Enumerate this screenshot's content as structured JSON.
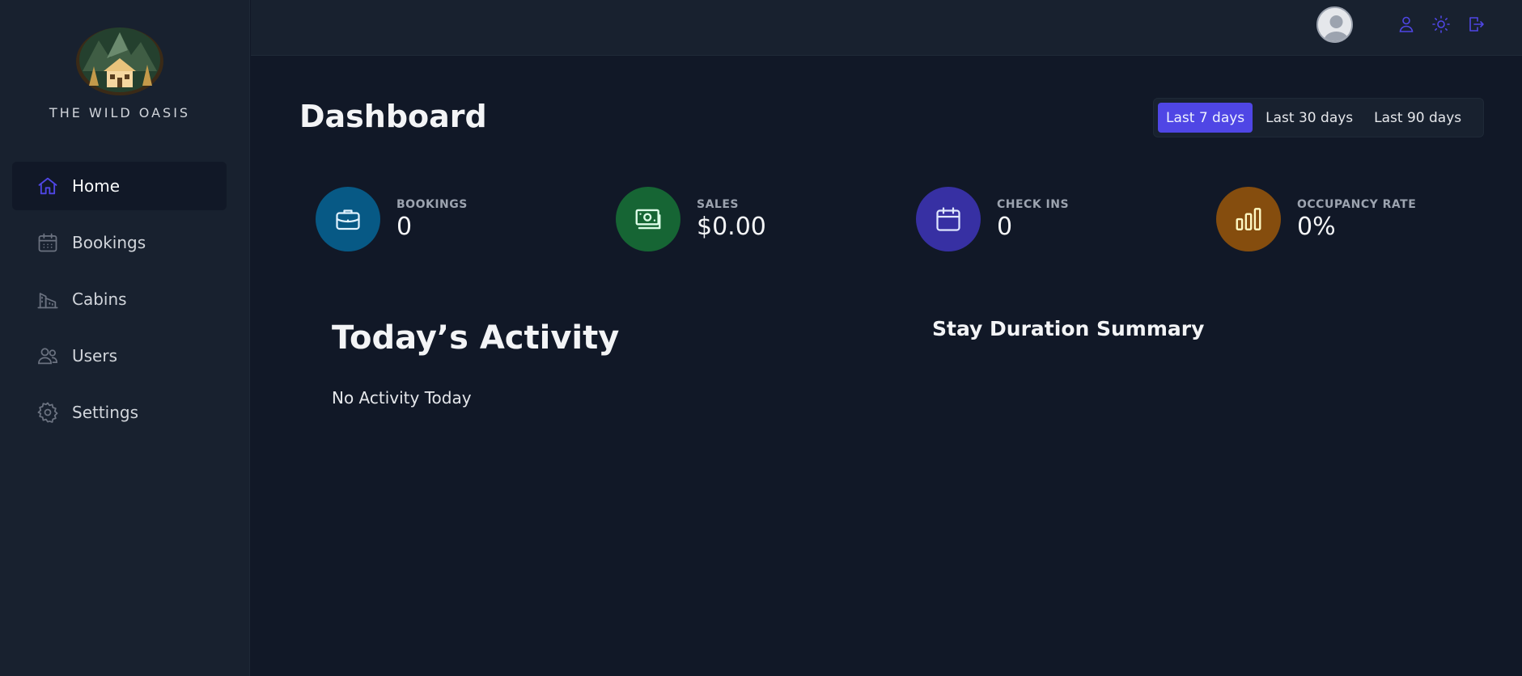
{
  "brand": {
    "name": "THE WILD OASIS"
  },
  "sidebar": {
    "items": [
      {
        "label": "Home",
        "icon": "home-icon",
        "active": true
      },
      {
        "label": "Bookings",
        "icon": "calendar-icon",
        "active": false
      },
      {
        "label": "Cabins",
        "icon": "building-icon",
        "active": false
      },
      {
        "label": "Users",
        "icon": "users-icon",
        "active": false
      },
      {
        "label": "Settings",
        "icon": "gear-icon",
        "active": false
      }
    ]
  },
  "header": {
    "icons": [
      "avatar",
      "user-icon",
      "sun-icon",
      "logout-icon"
    ]
  },
  "dashboard": {
    "title": "Dashboard",
    "filters": [
      {
        "label": "Last 7 days",
        "active": true
      },
      {
        "label": "Last 30 days",
        "active": false
      },
      {
        "label": "Last 90 days",
        "active": false
      }
    ],
    "stats": [
      {
        "label": "BOOKINGS",
        "value": "0",
        "icon": "briefcase-icon",
        "color": "#075985"
      },
      {
        "label": "SALES",
        "value": "$0.00",
        "icon": "banknotes-icon",
        "color": "#166534"
      },
      {
        "label": "CHECK INS",
        "value": "0",
        "icon": "calendar-icon",
        "color": "#3730a3"
      },
      {
        "label": "OCCUPANCY RATE",
        "value": "0%",
        "icon": "bar-chart-icon",
        "color": "#854d0e"
      }
    ],
    "activity": {
      "title": "Today’s Activity",
      "empty_text": "No Activity Today"
    },
    "duration": {
      "title": "Stay Duration Summary"
    }
  },
  "colors": {
    "accent": "#4f46e5",
    "background": "#111827",
    "panel": "#18212f"
  }
}
